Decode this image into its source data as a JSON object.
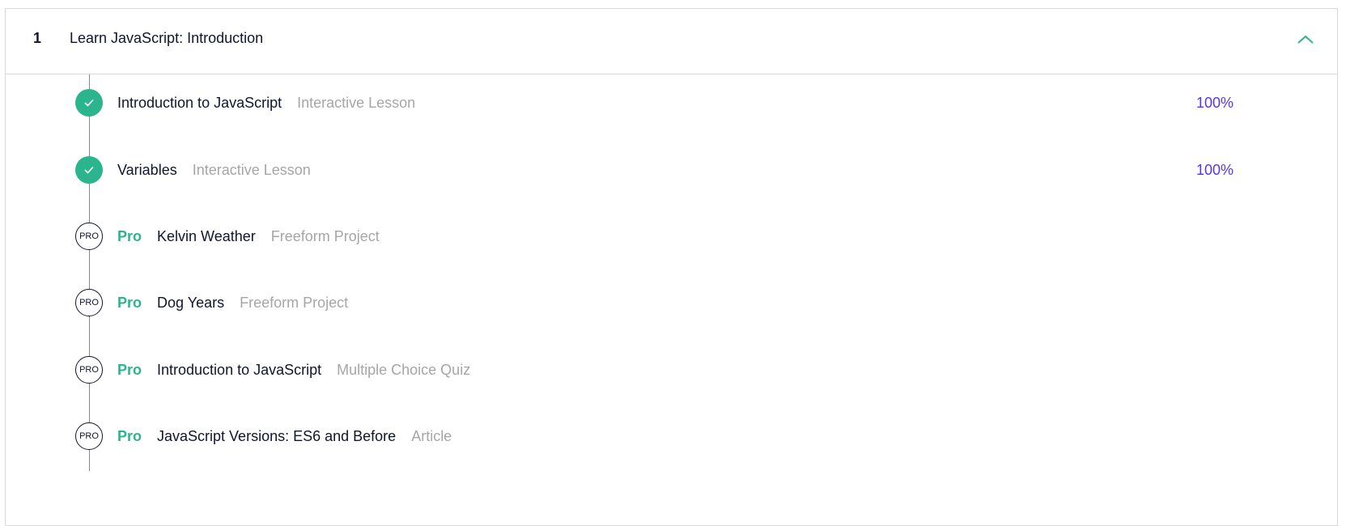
{
  "module": {
    "number": "1",
    "title": "Learn JavaScript: Introduction",
    "toggle_icon": "chevron-up-icon",
    "accent_color": "#2bb58f"
  },
  "items": [
    {
      "status": "complete",
      "pro_label": "",
      "title": "Introduction to JavaScript",
      "type": "Interactive Lesson",
      "progress": "100%"
    },
    {
      "status": "complete",
      "pro_label": "",
      "title": "Variables",
      "type": "Interactive Lesson",
      "progress": "100%"
    },
    {
      "status": "pro",
      "marker_text": "PRO",
      "pro_label": "Pro",
      "title": "Kelvin Weather",
      "type": "Freeform Project",
      "progress": ""
    },
    {
      "status": "pro",
      "marker_text": "PRO",
      "pro_label": "Pro",
      "title": "Dog Years",
      "type": "Freeform Project",
      "progress": ""
    },
    {
      "status": "pro",
      "marker_text": "PRO",
      "pro_label": "Pro",
      "title": "Introduction to JavaScript",
      "type": "Multiple Choice Quiz",
      "progress": ""
    },
    {
      "status": "pro",
      "marker_text": "PRO",
      "pro_label": "Pro",
      "title": "JavaScript Versions: ES6 and Before",
      "type": "Article",
      "progress": ""
    }
  ]
}
